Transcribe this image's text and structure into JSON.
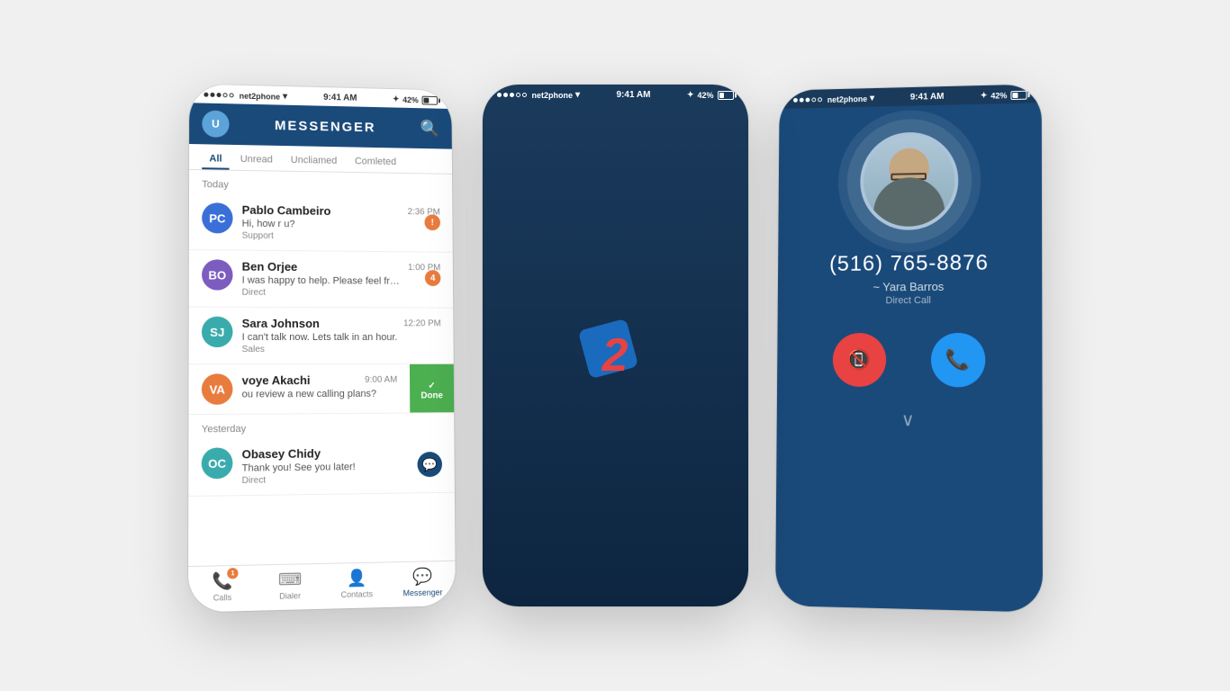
{
  "background": "#f0f0f0",
  "phones": {
    "phone1": {
      "statusBar": {
        "carrier": "net2phone",
        "wifi": "WiFi",
        "time": "9:41 AM",
        "bluetooth": "BT",
        "battery": "42%"
      },
      "header": {
        "title": "MESSENGER",
        "searchIcon": "search"
      },
      "tabs": [
        "All",
        "Unread",
        "Uncliamed",
        "Comleted"
      ],
      "activeTab": "All",
      "sections": [
        {
          "label": "Today",
          "conversations": [
            {
              "name": "Pablo Cambeiro",
              "time": "2:36 PM",
              "message": "Hi, how r u?",
              "tag": "Support",
              "badge": "!"
            },
            {
              "name": "Ben Orjee",
              "time": "1:00 PM",
              "message": "I was happy to help. Please feel free. Text me if you need something els...",
              "tag": "Direct",
              "badge": "4"
            },
            {
              "name": "Sara Johnson",
              "time": "12:20 PM",
              "message": "I can't talk now. Lets talk in an hour.",
              "tag": "Sales",
              "badge": ""
            },
            {
              "name": "voye Akachi",
              "time": "9:00 AM",
              "message": "ou review a new calling plans?",
              "tag": "",
              "badge": "",
              "swiped": true,
              "swipeLabel": "Done"
            }
          ]
        },
        {
          "label": "Yesterday",
          "conversations": [
            {
              "name": "Obasey Chidy",
              "time": "",
              "message": "Thank you! See you later!",
              "tag": "Direct",
              "badge": "chat"
            }
          ]
        }
      ],
      "bottomNav": [
        {
          "icon": "📞",
          "label": "Calls",
          "badge": "1",
          "active": false
        },
        {
          "icon": "⌨",
          "label": "Dialer",
          "badge": "",
          "active": false
        },
        {
          "icon": "👤",
          "label": "Contacts",
          "badge": "",
          "active": false
        },
        {
          "icon": "💬",
          "label": "Messenger",
          "badge": "",
          "active": true
        }
      ]
    },
    "phone2": {
      "statusBar": {
        "carrier": "net2phone",
        "wifi": "WiFi",
        "time": "9:41 AM",
        "bluetooth": "BT",
        "battery": "42%"
      },
      "splash": {
        "logoNumber": "2"
      }
    },
    "phone3": {
      "statusBar": {
        "carrier": "net2phone",
        "wifi": "WiFi",
        "time": "9:41 AM",
        "bluetooth": "BT",
        "battery": "42%"
      },
      "call": {
        "number": "(516) 765-8876",
        "name": "~ Yara Barros",
        "type": "Direct Call",
        "declineIcon": "📵",
        "acceptIcon": "📞"
      }
    }
  }
}
